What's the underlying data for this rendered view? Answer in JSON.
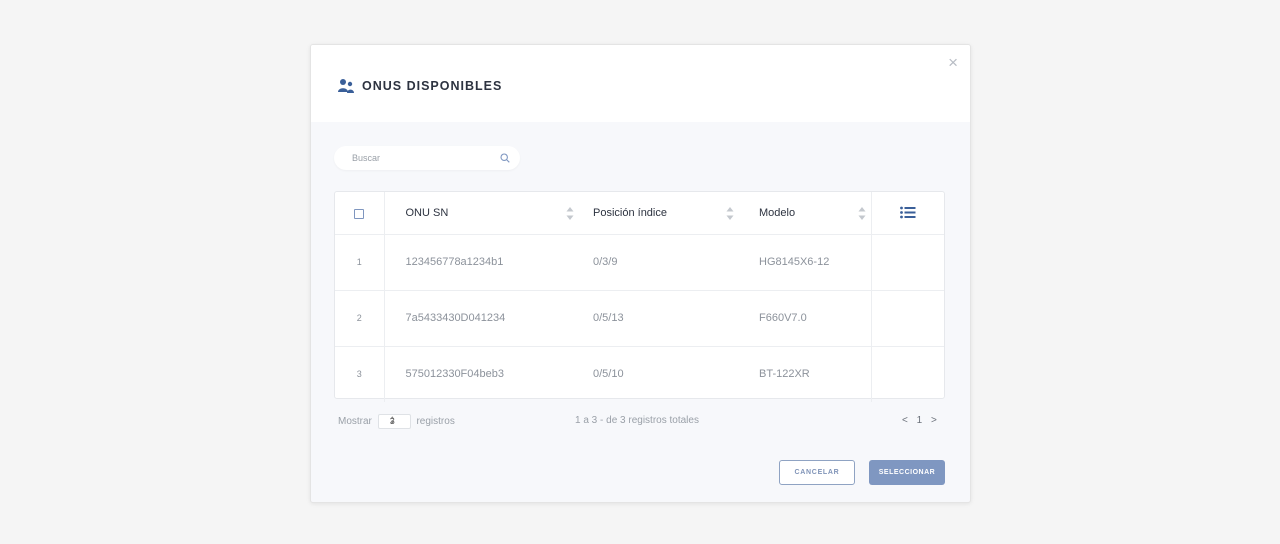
{
  "modal": {
    "title": "ONUS DISPONIBLES",
    "close": "×",
    "title_icon": "users-icon"
  },
  "search": {
    "placeholder": "Buscar",
    "value": ""
  },
  "table": {
    "columns": [
      "ONU SN",
      "Posición índice",
      "Modelo"
    ],
    "rows": [
      {
        "index": "1",
        "sn": "123456778a1234b1",
        "position": "0/3/9",
        "model": "HG8145X6-12"
      },
      {
        "index": "2",
        "sn": "7a5433430D041234",
        "position": "0/5/13",
        "model": "F660V7.0"
      },
      {
        "index": "3",
        "sn": "575012330F04beb3",
        "position": "0/5/10",
        "model": "BT-122XR"
      }
    ]
  },
  "footer": {
    "show_label": "Mostrar",
    "page_size": "3",
    "records_label": "registros",
    "summary": "1 a 3 - de 3 registros totales",
    "prev": "<",
    "page": "1",
    "next": ">"
  },
  "buttons": {
    "cancel": "CANCELAR",
    "select": "SELECCIONAR"
  },
  "colors": {
    "accent": "#7f97c1",
    "title_icon": "#3a5f99"
  }
}
